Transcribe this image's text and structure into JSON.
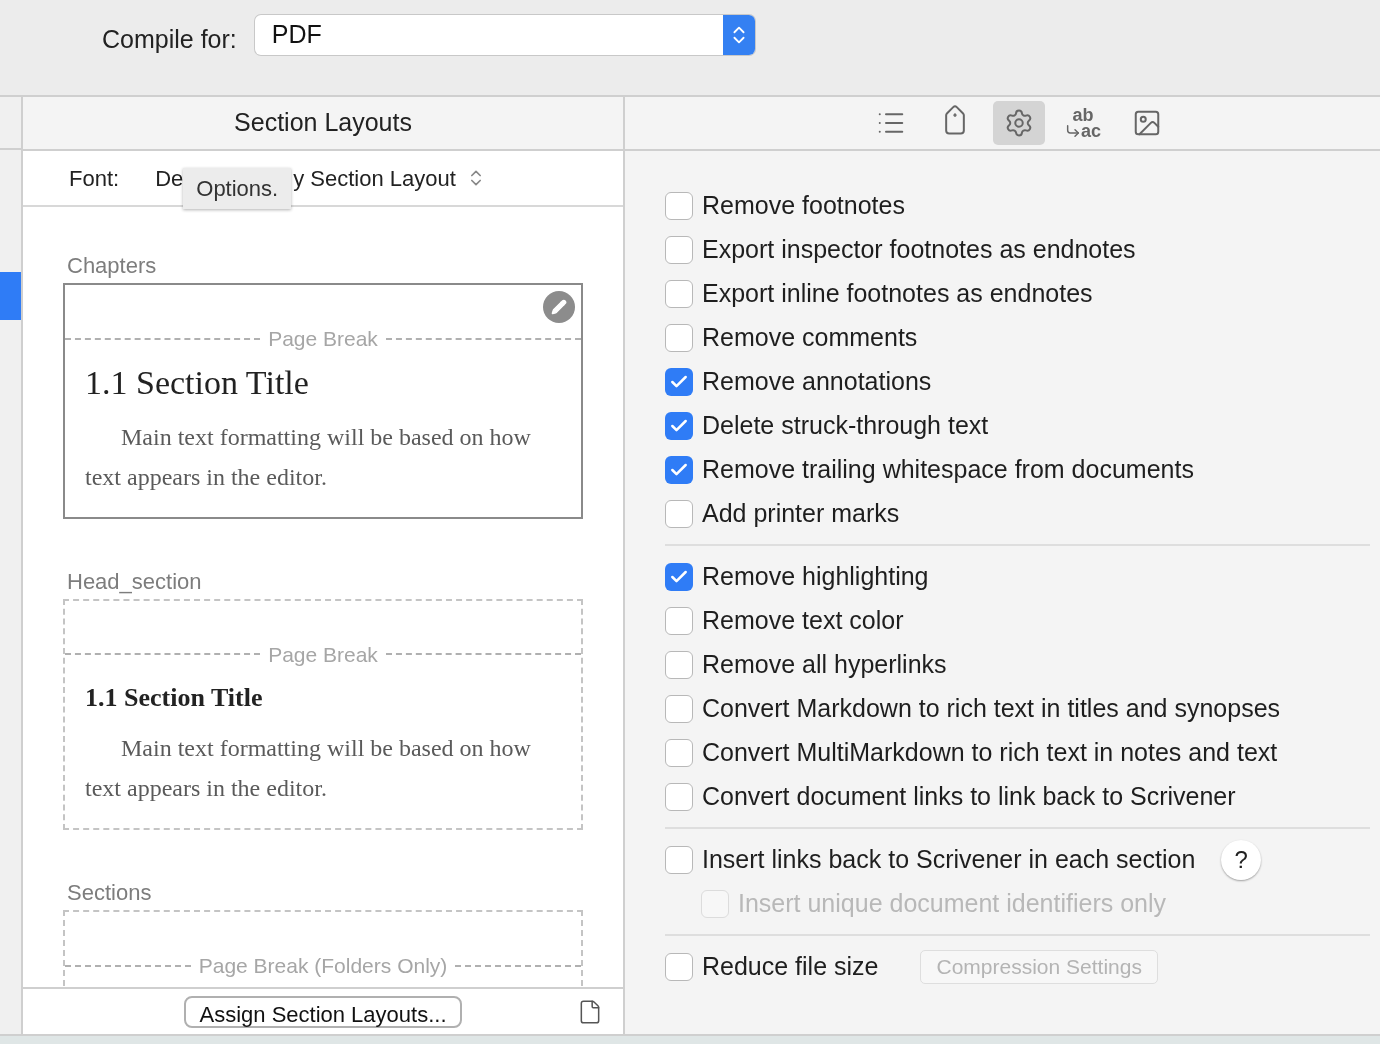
{
  "compile_for": {
    "label": "Compile for:",
    "value": "PDF"
  },
  "section_layouts": {
    "title": "Section Layouts",
    "font_label": "Font:",
    "font_value_start": "De",
    "font_value_end": "y Section Layout",
    "tooltip": "Options.",
    "layouts": [
      {
        "name": "Chapters",
        "dashed_border": false,
        "editable": true,
        "page_break": "Page Break",
        "title": "1.1 Section Title",
        "bold_title": false,
        "body": "Main text formatting will be based on how text appears in the editor."
      },
      {
        "name": "Head_section",
        "dashed_border": true,
        "editable": false,
        "page_break": "Page Break",
        "title": "1.1 Section Title",
        "bold_title": true,
        "body": "Main text formatting will be based on how text appears in the editor."
      },
      {
        "name": "Sections",
        "dashed_border": true,
        "editable": false,
        "page_break": "Page Break (Folders Only)"
      }
    ],
    "assign_button": "Assign Section Layouts..."
  },
  "toolbar": [
    {
      "kind": "list",
      "selected": false
    },
    {
      "kind": "tag",
      "selected": false
    },
    {
      "kind": "gear",
      "selected": true
    },
    {
      "kind": "replace",
      "top": "ab",
      "bottom": "ac",
      "selected": false
    },
    {
      "kind": "image",
      "selected": false
    }
  ],
  "option_groups": [
    [
      {
        "label": "Remove footnotes",
        "checked": false,
        "disabled": false
      },
      {
        "label": "Export inspector footnotes as endnotes",
        "checked": false,
        "disabled": false
      },
      {
        "label": "Export inline footnotes as endnotes",
        "checked": false,
        "disabled": false
      },
      {
        "label": "Remove comments",
        "checked": false,
        "disabled": false
      },
      {
        "label": "Remove annotations",
        "checked": true,
        "disabled": false
      },
      {
        "label": "Delete struck-through text",
        "checked": true,
        "disabled": false
      },
      {
        "label": "Remove trailing whitespace from documents",
        "checked": true,
        "disabled": false
      },
      {
        "label": "Add printer marks",
        "checked": false,
        "disabled": false
      }
    ],
    [
      {
        "label": "Remove highlighting",
        "checked": true,
        "disabled": false
      },
      {
        "label": "Remove text color",
        "checked": false,
        "disabled": false
      },
      {
        "label": "Remove all hyperlinks",
        "checked": false,
        "disabled": false
      },
      {
        "label": "Convert Markdown to rich text in titles and synopses",
        "checked": false,
        "disabled": false
      },
      {
        "label": "Convert MultiMarkdown to rich text in notes and text",
        "checked": false,
        "disabled": false
      },
      {
        "label": "Convert document links to link back to Scrivener",
        "checked": false,
        "disabled": false
      }
    ],
    [
      {
        "label": "Insert links back to Scrivener in each section",
        "checked": false,
        "disabled": false,
        "help": "?",
        "children": [
          {
            "label": "Insert unique document identifiers only",
            "checked": false,
            "disabled": true
          }
        ]
      }
    ],
    [
      {
        "label": "Reduce file size",
        "checked": false,
        "disabled": false,
        "button": {
          "label": "Compression Settings",
          "disabled": true
        }
      }
    ]
  ]
}
